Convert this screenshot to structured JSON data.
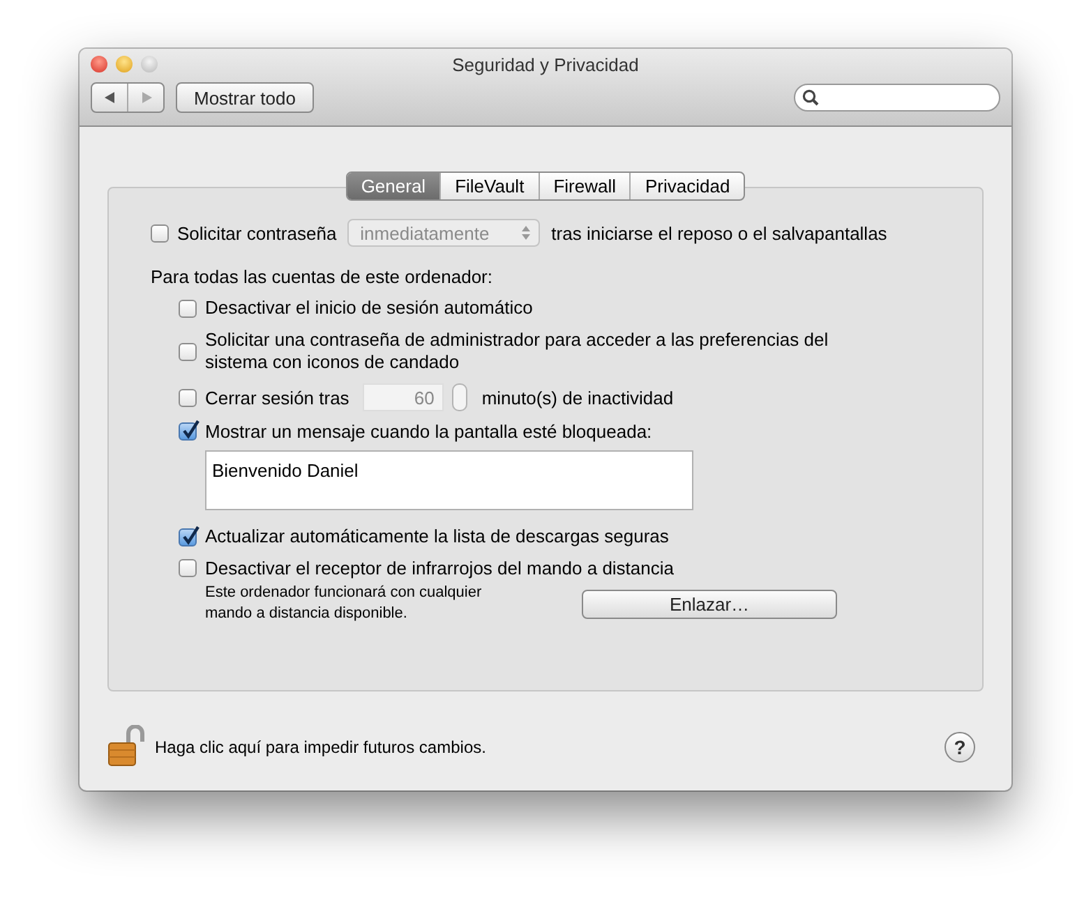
{
  "window": {
    "title": "Seguridad y Privacidad"
  },
  "toolbar": {
    "show_all": "Mostrar todo"
  },
  "tabs": [
    {
      "label": "General",
      "selected": true
    },
    {
      "label": "FileVault",
      "selected": false
    },
    {
      "label": "Firewall",
      "selected": false
    },
    {
      "label": "Privacidad",
      "selected": false
    }
  ],
  "require_password": {
    "label": "Solicitar contraseña",
    "checked": false,
    "popup": "inmediatamente",
    "suffix": "tras iniciarse el reposo o el salvapantallas"
  },
  "accounts_heading": "Para todas las cuentas de este ordenador:",
  "options": [
    {
      "kind": "checkbox",
      "label": "Desactivar el inicio de sesión automático",
      "checked": false
    },
    {
      "kind": "checkbox",
      "label": "Solicitar una contraseña de administrador para acceder a las preferencias del sistema con iconos de candado",
      "checked": false
    },
    {
      "kind": "stepper",
      "label": "Cerrar sesión tras",
      "value": "60",
      "suffix": "minuto(s) de inactividad",
      "checked": false
    },
    {
      "kind": "message",
      "label": "Mostrar un mensaje cuando la pantalla esté bloqueada:",
      "value": "Bienvenido Daniel",
      "checked": true
    },
    {
      "kind": "checkbox",
      "label": "Actualizar automáticamente la lista de descargas seguras",
      "checked": true
    },
    {
      "kind": "remote",
      "label": "Desactivar el receptor de infrarrojos del mando a distancia",
      "checked": false,
      "note": "Este ordenador funcionará con cualquier mando a distancia disponible.",
      "button": "Enlazar…"
    }
  ],
  "footer": {
    "lock_text": "Haga clic aquí para impedir futuros cambios.",
    "help": "?"
  }
}
